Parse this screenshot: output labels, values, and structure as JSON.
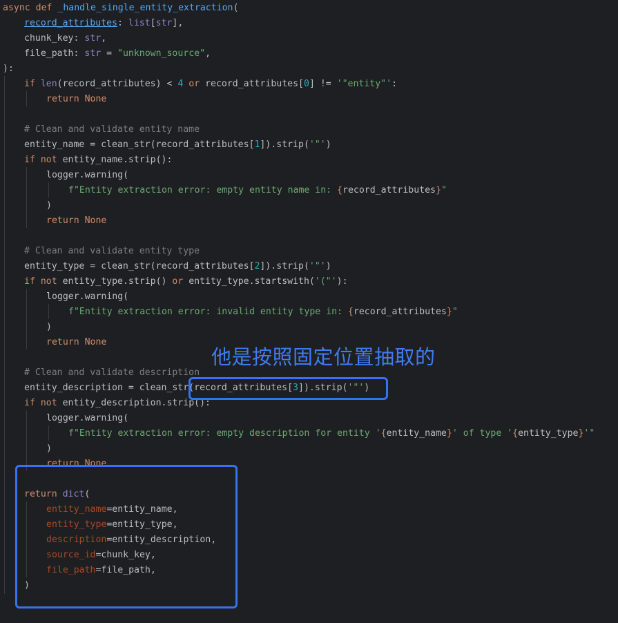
{
  "code": {
    "line_01": [
      "async",
      " def ",
      "_handle_single_entity_extraction",
      "("
    ],
    "line_02": [
      "record_attributes",
      ": ",
      "list",
      "[",
      "str",
      "],"
    ],
    "line_03": [
      "chunk_key",
      ": ",
      "str",
      ","
    ],
    "line_04": [
      "file_path",
      ": ",
      "str",
      " = ",
      "\"unknown_source\"",
      ","
    ],
    "line_05": [
      "):"
    ],
    "line_06": [
      "if",
      " ",
      "len",
      "(record_attributes) < ",
      "4",
      " ",
      "or",
      " record_attributes[",
      "0",
      "] != ",
      "'\"entity\"'",
      ":"
    ],
    "line_07": [
      "return",
      " ",
      "None"
    ],
    "line_09": [
      "# Clean and validate entity name"
    ],
    "line_10": [
      "entity_name = clean_str(record_attributes[",
      "1",
      "]).strip(",
      "'\"'",
      ")"
    ],
    "line_11": [
      "if",
      " ",
      "not",
      " entity_name.strip():"
    ],
    "line_12": [
      "logger.warning("
    ],
    "line_13": [
      "f\"Entity extraction error: empty entity name in: ",
      "{",
      "record_attributes",
      "}",
      "\""
    ],
    "line_14": [
      ")"
    ],
    "line_15": [
      "return",
      " ",
      "None"
    ],
    "line_17": [
      "# Clean and validate entity type"
    ],
    "line_18": [
      "entity_type = clean_str(record_attributes[",
      "2",
      "]).strip(",
      "'\"'",
      ")"
    ],
    "line_19": [
      "if",
      " ",
      "not",
      " entity_type.strip() ",
      "or",
      " entity_type.startswith(",
      "'(\"'",
      "):"
    ],
    "line_20": [
      "logger.warning("
    ],
    "line_21": [
      "f\"Entity extraction error: invalid entity type in: ",
      "{",
      "record_attributes",
      "}",
      "\""
    ],
    "line_22": [
      ")"
    ],
    "line_23": [
      "return",
      " ",
      "None"
    ],
    "line_25": [
      "# Clean and validate description"
    ],
    "line_26": [
      "entity_description = clean_str(record_attributes[",
      "3",
      "]).strip(",
      "'\"'",
      ")"
    ],
    "line_27": [
      "if",
      " ",
      "not",
      " entity_description.strip():"
    ],
    "line_28": [
      "logger.warning("
    ],
    "line_29": [
      "f\"Entity extraction error: empty description for entity '",
      "{",
      "entity_name",
      "}",
      "' of type '",
      "{",
      "entity_type",
      "}",
      "'\""
    ],
    "line_30": [
      ")"
    ],
    "line_31": [
      "return",
      " ",
      "None"
    ],
    "line_33": [
      "return",
      " ",
      "dict",
      "("
    ],
    "line_34": [
      "entity_name",
      "=entity_name,"
    ],
    "line_35": [
      "entity_type",
      "=entity_type,"
    ],
    "line_36": [
      "description",
      "=entity_description,"
    ],
    "line_37": [
      "source_id",
      "=chunk_key,"
    ],
    "line_38": [
      "file_path",
      "=file_path,"
    ],
    "line_39": [
      ")"
    ]
  },
  "annotation": {
    "text": "他是按照固定位置抽取的"
  },
  "colors": {
    "background": "#1e1f22",
    "keyword": "#cf8e6d",
    "function": "#56a8f5",
    "string": "#6aab73",
    "number": "#2aacb8",
    "comment": "#7a7e85",
    "builtin": "#8888c6",
    "kwarg": "#aa4926",
    "highlight_box": "#3574f0"
  }
}
